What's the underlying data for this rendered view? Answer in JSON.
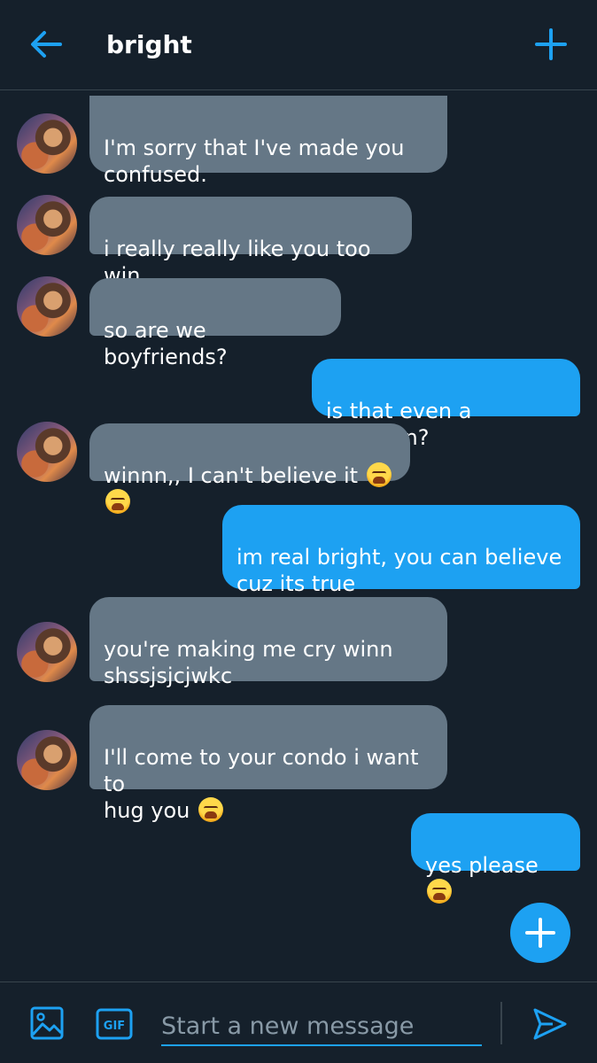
{
  "header": {
    "title": "bright",
    "accent": "#1da1f2",
    "icons": [
      "arrow-left-icon",
      "plus-icon"
    ]
  },
  "messages": [
    {
      "direction": "received",
      "text": "I'm sorry that I've made you\nconfused.",
      "emojis": 0
    },
    {
      "direction": "received",
      "text": "i really really like you too win.",
      "emojis": 0
    },
    {
      "direction": "received",
      "text": "so are we boyfriends?",
      "emojis": 0
    },
    {
      "direction": "sent",
      "text": "is that even a question?",
      "emojis": 0
    },
    {
      "direction": "received",
      "text": "winnn,, I can't believe it ",
      "emojis": 2
    },
    {
      "direction": "sent",
      "text": "im real bright, you can believe\ncuz its true",
      "emojis": 0
    },
    {
      "direction": "received",
      "text": "you're making me cry winn\nshssjsjcjwkc",
      "emojis": 0
    },
    {
      "direction": "received",
      "text": "I'll come to your condo i want to\nhug you ",
      "emojis": 1
    },
    {
      "direction": "sent",
      "text": "yes please ",
      "emojis": 1
    }
  ],
  "colors": {
    "background": "#15202b",
    "received_bubble": "#657786",
    "sent_bubble": "#1da1f2",
    "divider": "#38444d"
  },
  "composer": {
    "placeholder": "Start a new message",
    "value": "",
    "icons": [
      "image-icon",
      "gif-icon",
      "send-icon"
    ]
  },
  "fab": {
    "icon": "plus-icon"
  }
}
